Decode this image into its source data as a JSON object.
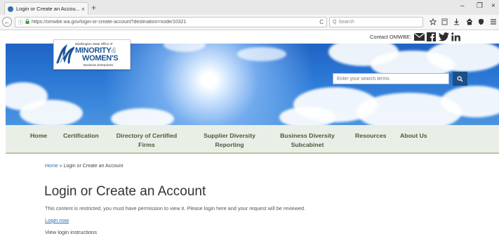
{
  "browser": {
    "tab_title": "Login or Create an Accou...",
    "tab_close": "×",
    "new_tab": "+",
    "win_min": "–",
    "win_max": "❐",
    "win_close": "×",
    "url": "https://omwbe.wa.gov/login-or-create-account?destination=node/10321",
    "search_placeholder": "Search",
    "back_glyph": "←",
    "info_glyph": "ⓘ",
    "lock_glyph": "🔒",
    "reload_glyph": "C",
    "search_glyph": "Q",
    "toolbar_icons": [
      "star-icon",
      "bookmarks-icon",
      "download-icon",
      "home-icon",
      "shield-icon",
      "menu-icon"
    ]
  },
  "header": {
    "contact_label": "Contact OMWBE:",
    "logo": {
      "superscript": "Washington State Office of",
      "line1": "MINORITY",
      "ampersand": "&",
      "line2": "WOMEN'S",
      "line3": "Business Enterprises"
    },
    "search_placeholder": "Enter your search terms",
    "search_button_icon": "search-icon"
  },
  "nav": {
    "items": [
      {
        "line1": "Home",
        "line2": ""
      },
      {
        "line1": "Certification",
        "line2": ""
      },
      {
        "line1": "Directory of Certified",
        "line2": "Firms"
      },
      {
        "line1": "Supplier Diversity",
        "line2": "Reporting"
      },
      {
        "line1": "Business Diversity",
        "line2": "Subcabinet"
      },
      {
        "line1": "Resources",
        "line2": ""
      },
      {
        "line1": "About Us",
        "line2": ""
      }
    ]
  },
  "content": {
    "breadcrumb_home": "Home",
    "breadcrumb_sep": " » ",
    "breadcrumb_current": "Login or Create an Account",
    "title": "Login or Create an Account",
    "message": "This content is restricted, you must have permission to view it.  Please login here and your request will be reviewed.",
    "login_link": "Login now",
    "instructions": "View login instructions"
  },
  "colors": {
    "brand_blue": "#1b5595",
    "nav_bg": "#e9efe6",
    "nav_text": "#4a5a3a",
    "link": "#2a6fb7",
    "search_button": "#1c4f86"
  }
}
